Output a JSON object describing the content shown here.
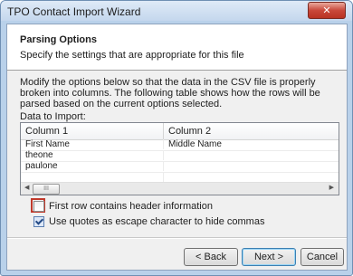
{
  "window": {
    "title": "TPO Contact Import Wizard",
    "close_glyph": "✕"
  },
  "header": {
    "title": "Parsing Options",
    "subtitle": "Specify the settings that are appropriate for this file"
  },
  "description": "Modify the options below so that the data in the CSV file is properly broken into columns. The following table shows how the rows will be parsed based on the current options selected.",
  "data_label": "Data to Import:",
  "table": {
    "columns": [
      "Column 1",
      "Column 2"
    ],
    "rows": [
      [
        "First Name",
        "Middle Name"
      ],
      [
        "theone",
        ""
      ],
      [
        "paulone",
        ""
      ],
      [
        "",
        ""
      ]
    ],
    "scrollbar": {
      "thumb_glyph": "III",
      "left_arrow": "◀",
      "right_arrow": "▶"
    }
  },
  "options": {
    "header_row": {
      "label": "First row contains header information",
      "checked": false
    },
    "quotes_escape": {
      "label": "Use quotes as escape character to hide commas",
      "checked": true
    }
  },
  "buttons": {
    "back": "< Back",
    "next": "Next >",
    "cancel": "Cancel"
  },
  "colors": {
    "highlight": "#c0392b",
    "accent": "#3c7fb1"
  }
}
